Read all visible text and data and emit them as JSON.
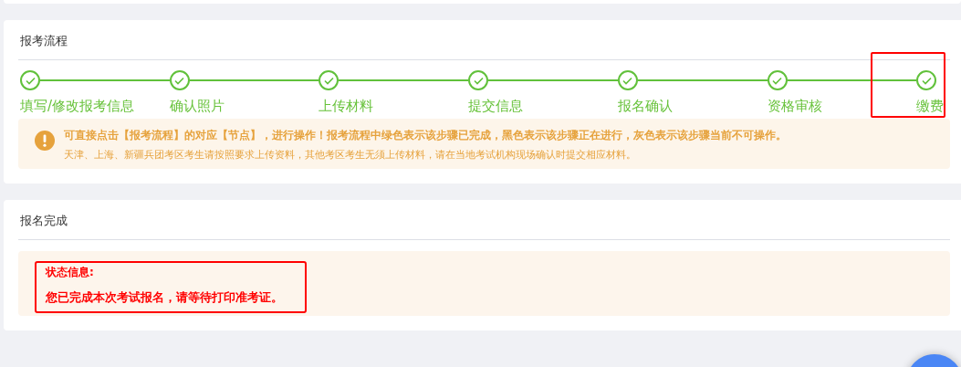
{
  "process": {
    "title": "报考流程",
    "steps": [
      {
        "label": "填写/修改报考信息",
        "done": true,
        "highlighted": false
      },
      {
        "label": "确认照片",
        "done": true,
        "highlighted": false
      },
      {
        "label": "上传材料",
        "done": true,
        "highlighted": false
      },
      {
        "label": "提交信息",
        "done": true,
        "highlighted": false
      },
      {
        "label": "报名确认",
        "done": true,
        "highlighted": false
      },
      {
        "label": "资格审核",
        "done": true,
        "highlighted": false
      },
      {
        "label": "缴费",
        "done": true,
        "highlighted": true
      }
    ],
    "notice": {
      "title": "可直接点击【报考流程】的对应【节点】，进行操作！报考流程中绿色表示该步骤已完成，黑色表示该步骤正在进行，灰色表示该步骤当前不可操作。",
      "text": "天津、上海、新疆兵团考区考生请按照要求上传资料，其他考区考生无须上传材料，请在当地考试机构现场确认时提交相应材料。"
    }
  },
  "result": {
    "title": "报名完成",
    "status_label": "状态信息:",
    "status_text": "您已完成本次考试报名，请等待打印准考证。",
    "highlighted": true
  }
}
